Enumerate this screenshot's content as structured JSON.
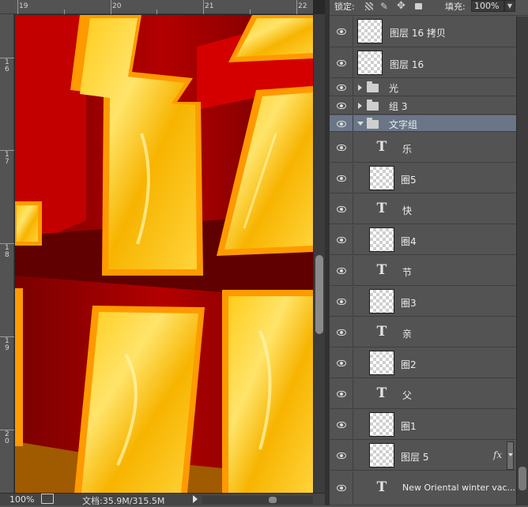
{
  "ruler": {
    "top_labels": [
      "19",
      "20",
      "21",
      "22"
    ],
    "left_labels": [
      "1\n6",
      "1\n7",
      "1\n8",
      "1\n9",
      "2\n0"
    ]
  },
  "status": {
    "zoom": "100%",
    "doc_size": "文档:35.9M/315.5M"
  },
  "layers_panel": {
    "lock_label": "锁定:",
    "fill_label": "填充:",
    "fill_value": "100%",
    "icons": [
      "checker-lock-icon",
      "brush-lock-icon",
      "move-lock-icon",
      "padlock-icon"
    ],
    "layers": [
      {
        "name": "图层 16 拷贝",
        "kind": "pixel"
      },
      {
        "name": "图层 16",
        "kind": "pixel"
      },
      {
        "name": "光",
        "kind": "group-closed"
      },
      {
        "name": "组 3",
        "kind": "group-closed"
      },
      {
        "name": "文字组",
        "kind": "group-open",
        "selected": true
      },
      {
        "name": "乐",
        "kind": "text"
      },
      {
        "name": "圈5",
        "kind": "pixel"
      },
      {
        "name": "快",
        "kind": "text"
      },
      {
        "name": "圈4",
        "kind": "pixel"
      },
      {
        "name": "节",
        "kind": "text"
      },
      {
        "name": "圈3",
        "kind": "pixel"
      },
      {
        "name": "亲",
        "kind": "text"
      },
      {
        "name": "圈2",
        "kind": "pixel"
      },
      {
        "name": "父",
        "kind": "text"
      },
      {
        "name": "圈1",
        "kind": "pixel"
      },
      {
        "name": "图层 5",
        "kind": "pixel",
        "fx": "fx"
      },
      {
        "name": "New Oriental winter vac...",
        "kind": "text"
      }
    ]
  }
}
